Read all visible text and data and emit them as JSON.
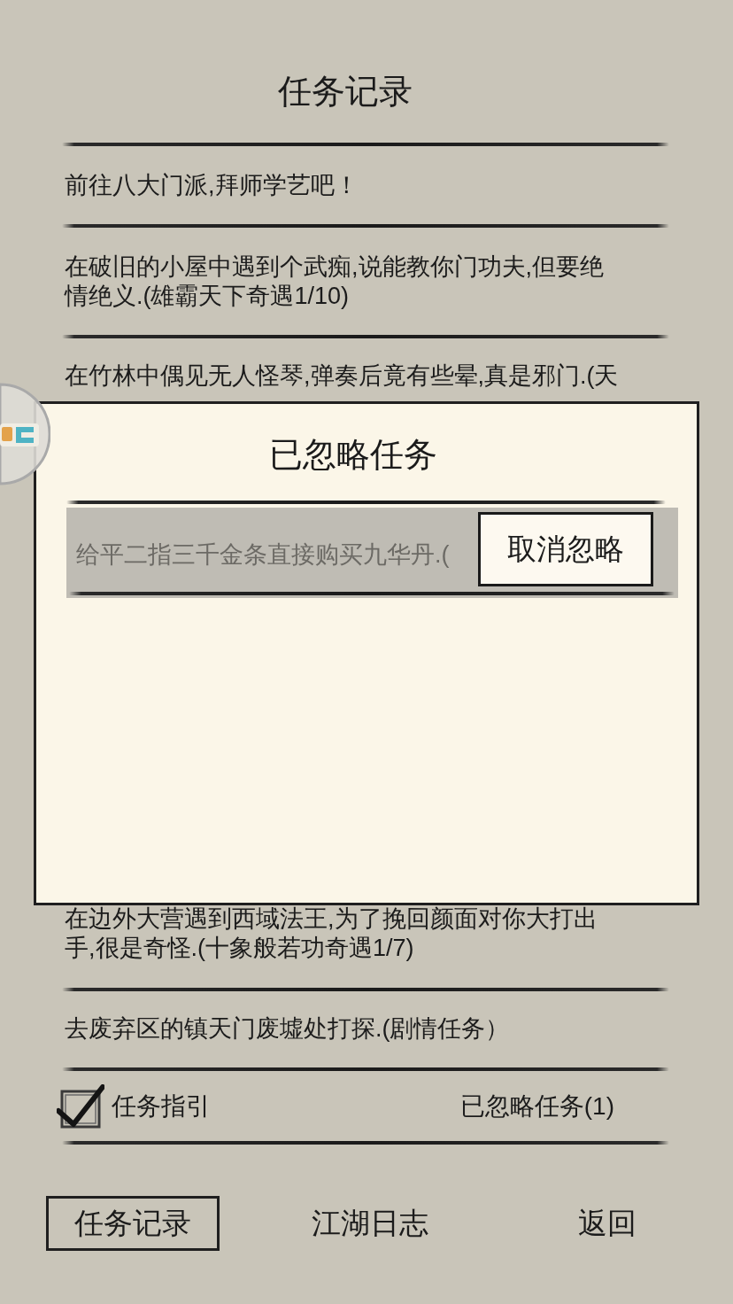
{
  "title": "任务记录",
  "tasks_above_dialog": [
    {
      "text": "前往八大门派,拜师学艺吧！"
    },
    {
      "text": "在破旧的小屋中遇到个武痴,说能教你门功夫,但要绝情绝义.(雄霸天下奇遇1/10)"
    },
    {
      "text": "在竹林中偶见无人怪琴,弹奏后竟有些晕,真是邪门.(天"
    }
  ],
  "dialog": {
    "title": "已忽略任务",
    "items": [
      {
        "text": "给平二指三千金条直接购买九华丹.(",
        "button": "取消忽略"
      }
    ]
  },
  "tasks_below_dialog": [
    {
      "text": "在边外大营遇到西域法王,为了挽回颜面对你大打出手,很是奇怪.(十象般若功奇遇1/7)"
    },
    {
      "text": "去废弃区的镇天门废墟处打探.(剧情任务）"
    }
  ],
  "guide": {
    "label": "任务指引",
    "checked": true
  },
  "ignored_link": "已忽略任务(1)",
  "nav": [
    {
      "label": "任务记录",
      "selected": true
    },
    {
      "label": "江湖日志",
      "selected": false
    },
    {
      "label": "返回",
      "selected": false
    }
  ]
}
